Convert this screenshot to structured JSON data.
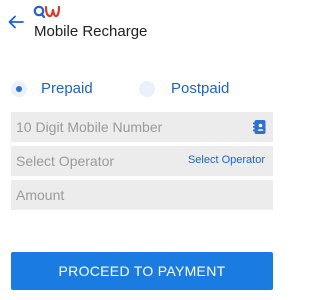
{
  "header": {
    "title": "Mobile Recharge",
    "back_icon": "arrow-left-icon",
    "logo_icon": "brand-logo-icon"
  },
  "plan": {
    "options": [
      {
        "label": "Prepaid",
        "checked": true
      },
      {
        "label": "Postpaid",
        "checked": false
      }
    ]
  },
  "form": {
    "mobile_placeholder": "10 Digit Mobile Number",
    "mobile_value": "",
    "operator_placeholder": "Select Operator",
    "operator_link": "Select Operator",
    "amount_placeholder": "Amount",
    "amount_value": "",
    "contact_icon": "contact-book-icon"
  },
  "actions": {
    "proceed_label": "PROCEED TO PAYMENT"
  },
  "colors": {
    "accent": "#1e63c9",
    "button": "#1a7be0",
    "field_bg": "#ececec"
  }
}
